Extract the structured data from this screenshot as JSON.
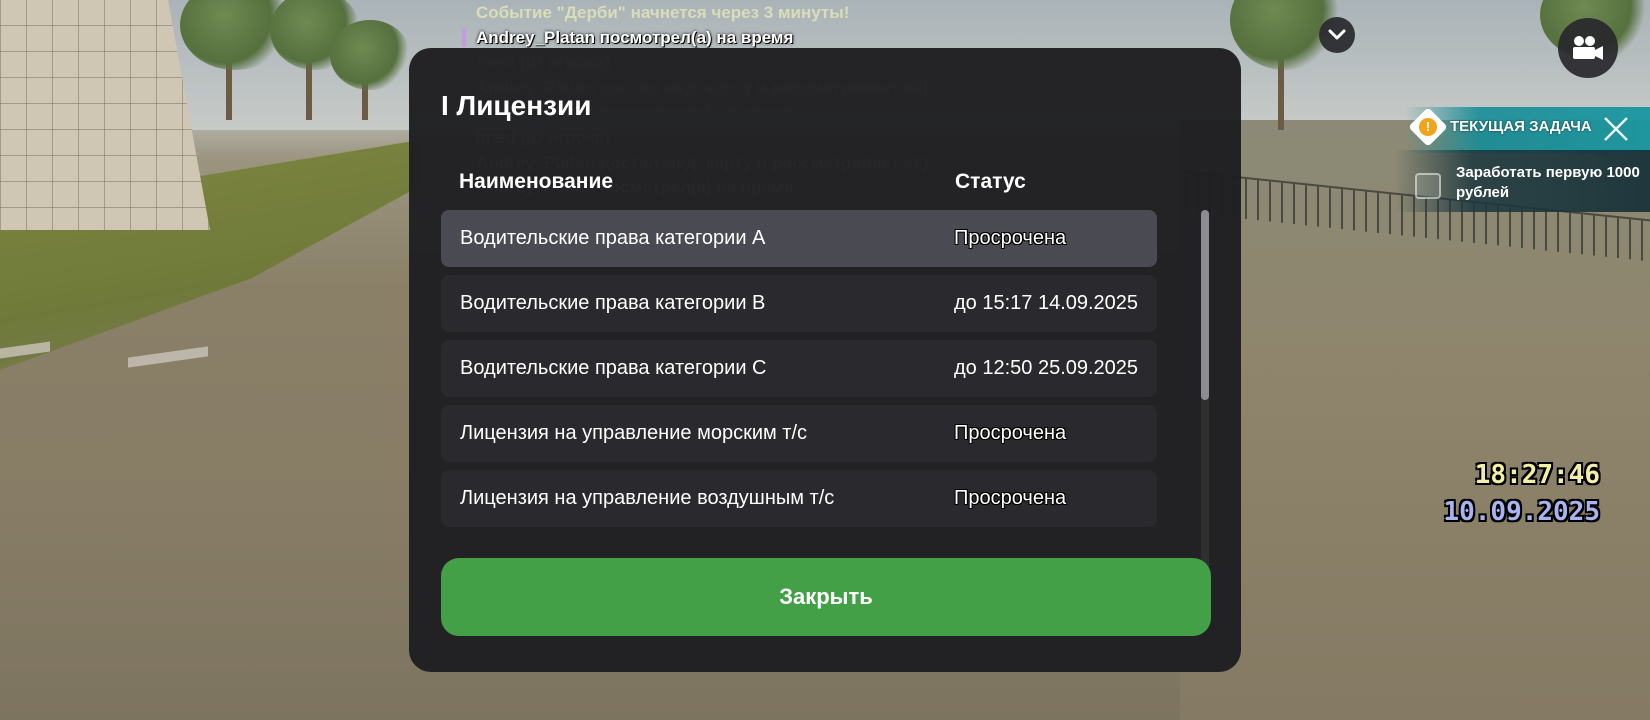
{
  "chat": [
    {
      "text": "Событие \"Дерби\" начнется через 3 минуты!",
      "style": "event",
      "marked": false
    },
    {
      "text": "Andrey_Platan посмотрел(а) на время",
      "style": "bright",
      "marked": true
    },
    {
      "text": "/med [ID игрока]",
      "style": "dim",
      "marked": false
    },
    {
      "text": "Andrey_Platan достал мед. карту и рассматривает её)",
      "style": "dim",
      "marked": false
    },
    {
      "text": "Andrey_Platan посмотрел(а) на время",
      "style": "dim",
      "marked": false
    },
    {
      "text": "/med [ID игрока]",
      "style": "dim",
      "marked": false
    },
    {
      "text": "Andrey_Platan достал мед. карту и рассматривает её)",
      "style": "dim",
      "marked": false
    },
    {
      "text": "Andrey_Platan посмотрел(а) на время",
      "style": "dim",
      "marked": false
    }
  ],
  "task": {
    "header": "ТЕКУЩАЯ ЗАДАЧА",
    "badge": "!",
    "text": "Заработать первую 1000 рублей",
    "done": false
  },
  "clock": {
    "time": "18:27:46",
    "date": "10.09.2025"
  },
  "modal": {
    "title": "I Лицензии",
    "columns": {
      "name": "Наименование",
      "status": "Статус"
    },
    "rows": [
      {
        "name": "Водительские права категории A",
        "status": "Просрочена",
        "selected": true,
        "expired": true
      },
      {
        "name": "Водительские права категории B",
        "status": "до 15:17 14.09.2025",
        "selected": false,
        "expired": false
      },
      {
        "name": "Водительские права категории C",
        "status": "до 12:50 25.09.2025",
        "selected": false,
        "expired": false
      },
      {
        "name": "Лицензия на управление морским т/с",
        "status": "Просрочена",
        "selected": false,
        "expired": true
      },
      {
        "name": "Лицензия на управление воздушным т/с",
        "status": "Просрочена",
        "selected": false,
        "expired": true
      }
    ],
    "close_label": "Закрыть"
  },
  "icons": {
    "collapse": "chevron-down-icon",
    "camera": "video-camera-icon",
    "close_task": "close-icon"
  },
  "colors": {
    "accent_green": "#43a046",
    "task_teal": "#19969f",
    "clock_time": "#f1f0a6",
    "clock_date": "#a9b3f0"
  }
}
